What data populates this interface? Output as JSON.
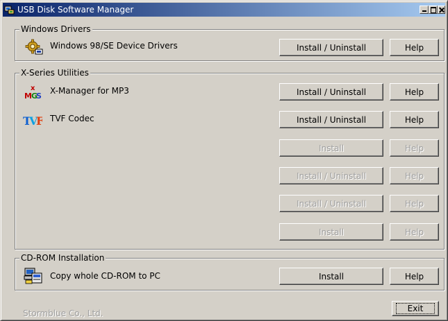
{
  "window": {
    "title": "USB Disk Software Manager"
  },
  "groups": {
    "drivers": {
      "label": "Windows Drivers",
      "items": [
        {
          "label": "Windows 98/SE Device Drivers",
          "icon": "driver-gear-icon",
          "install_label": "Install / Uninstall",
          "help_label": "Help",
          "enabled": true
        }
      ]
    },
    "utilities": {
      "label": "X-Series Utilities",
      "items": [
        {
          "label": "X-Manager for MP3",
          "icon": "xmg-logo-icon",
          "install_label": "Install / Uninstall",
          "help_label": "Help",
          "enabled": true
        },
        {
          "label": "TVF Codec",
          "icon": "tvf-logo-icon",
          "install_label": "Install / Uninstall",
          "help_label": "Help",
          "enabled": true
        },
        {
          "label": "",
          "icon": "",
          "install_label": "Install",
          "help_label": "Help",
          "enabled": false
        },
        {
          "label": "",
          "icon": "",
          "install_label": "Install / Uninstall",
          "help_label": "Help",
          "enabled": false
        },
        {
          "label": "",
          "icon": "",
          "install_label": "Install / Uninstall",
          "help_label": "Help",
          "enabled": false
        },
        {
          "label": "",
          "icon": "",
          "install_label": "Install",
          "help_label": "Help",
          "enabled": false
        }
      ]
    },
    "cdrom": {
      "label": "CD-ROM Installation",
      "items": [
        {
          "label": "Copy whole CD-ROM to PC",
          "icon": "computer-setup-icon",
          "install_label": "Install",
          "help_label": "Help",
          "enabled": true
        }
      ]
    }
  },
  "footer": {
    "company": "Stormblue Co., Ltd.",
    "exit_label": "Exit"
  },
  "colors": {
    "titlebar_start": "#0a246a",
    "titlebar_end": "#a6caf0",
    "face": "#d4d0c8",
    "disabled_text": "#a0a0a0"
  }
}
